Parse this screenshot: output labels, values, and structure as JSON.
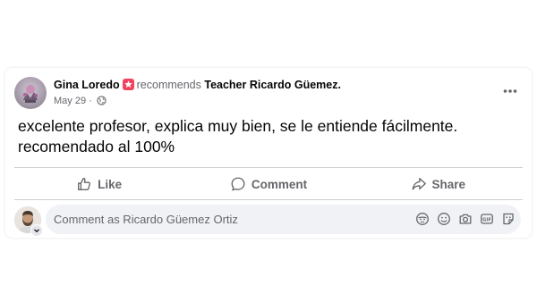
{
  "post": {
    "author": "Gina Loredo",
    "verb": "recommends",
    "target": "Teacher Ricardo Güemez",
    "target_suffix": ".",
    "date": "May 29",
    "separator": " · ",
    "text": "excelente profesor, explica muy bien, se le entiende fácilmente. recomendado al 100%"
  },
  "actions": {
    "like": "Like",
    "comment": "Comment",
    "share": "Share"
  },
  "comment_box": {
    "placeholder": "Comment as Ricardo Güemez Ortiz"
  },
  "icons": {
    "recommend": "recommend-star-icon",
    "privacy": "globe-icon",
    "more": "more-options-icon",
    "like": "thumbs-up-icon",
    "comment": "comment-bubble-icon",
    "share": "share-arrow-icon",
    "avatar_sticker": "avatar-sticker-icon",
    "emoji": "emoji-icon",
    "camera": "camera-icon",
    "gif": "gif-icon",
    "sticker": "sticker-icon"
  },
  "colors": {
    "recommend_badge": "#f3425f",
    "secondary_text": "#65676b",
    "input_bg": "#f0f2f5"
  }
}
